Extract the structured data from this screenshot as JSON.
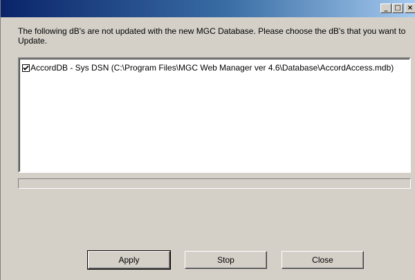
{
  "window": {
    "title": "",
    "controls": {
      "minimize_glyph": "_",
      "maximize_glyph": "□",
      "close_glyph": "×"
    }
  },
  "message": "The following dB's are not updated with the new MGC Database. Please choose the dB's that you want to Update.",
  "databases": [
    {
      "checked": true,
      "label": "AccordDB - Sys DSN (C:\\Program Files\\MGC Web Manager ver 4.6\\Database\\AccordAccess.mdb)"
    }
  ],
  "progress": {
    "value": 0
  },
  "buttons": {
    "apply": "Apply",
    "stop": "Stop",
    "close": "Close"
  }
}
